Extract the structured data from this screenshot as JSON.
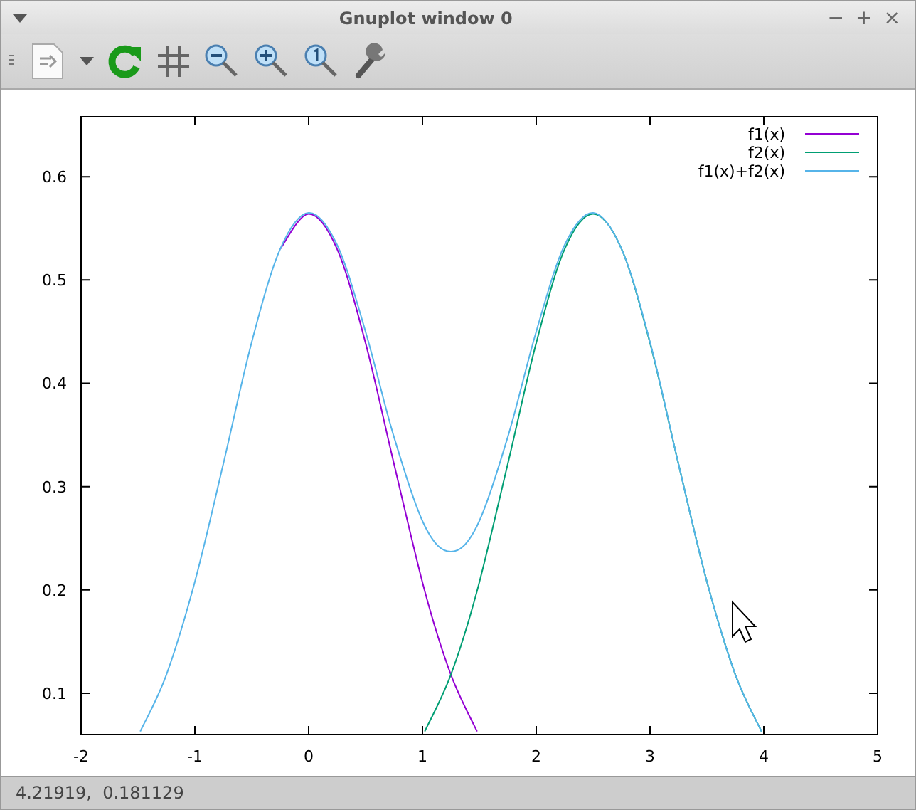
{
  "window": {
    "title": "Gnuplot window 0",
    "controls": [
      "−",
      "+",
      "×"
    ]
  },
  "plot": {
    "chart_data": {
      "type": "line",
      "legend": true,
      "x": [
        -1.48,
        -1.25,
        -1,
        -0.75,
        -0.5,
        -0.25,
        0,
        0.25,
        0.5,
        0.75,
        1.02,
        1.25,
        1.48,
        1.75,
        2,
        2.25,
        2.5,
        2.75,
        3,
        3.25,
        3.5,
        3.75,
        3.98
      ],
      "series": [
        {
          "name": "f1(x)",
          "color": "#9400d3",
          "values": [
            null,
            null,
            null,
            null,
            null,
            0.53,
            0.564,
            0.53,
            0.439,
            0.322,
            0.199,
            0.118,
            0.063,
            null,
            null,
            null,
            null,
            null,
            null,
            null,
            null,
            null,
            null
          ]
        },
        {
          "name": "f2(x)",
          "color": "#009e73",
          "values": [
            null,
            null,
            null,
            null,
            null,
            null,
            null,
            null,
            null,
            null,
            0.063,
            0.118,
            0.199,
            0.322,
            0.439,
            0.53,
            0.564,
            0.53,
            0.439,
            0.322,
            0.208,
            0.118,
            0.063
          ]
        },
        {
          "name": "f1(x)+f2(x)",
          "color": "#56b4e9",
          "values": [
            0.063,
            0.118,
            0.208,
            0.322,
            0.44,
            0.53,
            0.565,
            0.534,
            0.45,
            0.348,
            0.262,
            0.237,
            0.262,
            0.348,
            0.45,
            0.534,
            0.565,
            0.53,
            0.44,
            0.322,
            0.208,
            0.118,
            0.063
          ]
        }
      ],
      "xlim": [
        -2,
        5
      ],
      "ylim": [
        0.06,
        0.658
      ],
      "xticks": [
        -2,
        -1,
        0,
        1,
        2,
        3,
        4,
        5
      ],
      "yticks": [
        0.1,
        0.2,
        0.3,
        0.4,
        0.5,
        0.6
      ]
    }
  },
  "status_bar": {
    "text": "4.21919,  0.181129"
  }
}
